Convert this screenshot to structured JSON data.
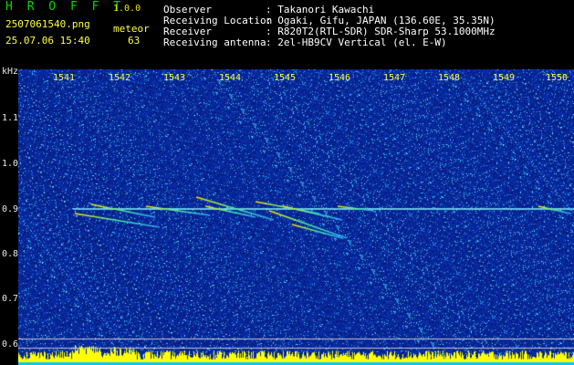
{
  "app": {
    "title": "H R O F F T",
    "version": "1.0.0",
    "filename": "2507061540.png",
    "datetime": "25.07.06 15:40",
    "count_label": "meteor",
    "count": "63"
  },
  "info": {
    "observer_label": "Observer",
    "observer": ": Takanori Kawachi",
    "location_label": "Receiving Location",
    "location": ": Ogaki, Gifu, JAPAN (136.60E, 35.35N)",
    "receiver_label": "Receiver",
    "receiver": ": R820T2(RTL-SDR) SDR-Sharp 53.1000MHz",
    "antenna_label": "Receiving antenna",
    "antenna": ": 2el-HB9CV Vertical (el. E-W)"
  },
  "axis": {
    "unit": "kHz",
    "time_ticks": [
      "1541",
      "1542",
      "1543",
      "1544",
      "1545",
      "1546",
      "1547",
      "1548",
      "1549",
      "1550"
    ],
    "freq_ticks": [
      "1.1",
      "1.0",
      "0.9",
      "0.8",
      "0.7",
      "0.6"
    ]
  },
  "colors": {
    "background": "#000000",
    "noise": "#0a1a8c",
    "carrier": "#6af0ff",
    "meteor": "#ffe000",
    "level_bar": "#ffff00",
    "logo": "#00d800"
  }
}
